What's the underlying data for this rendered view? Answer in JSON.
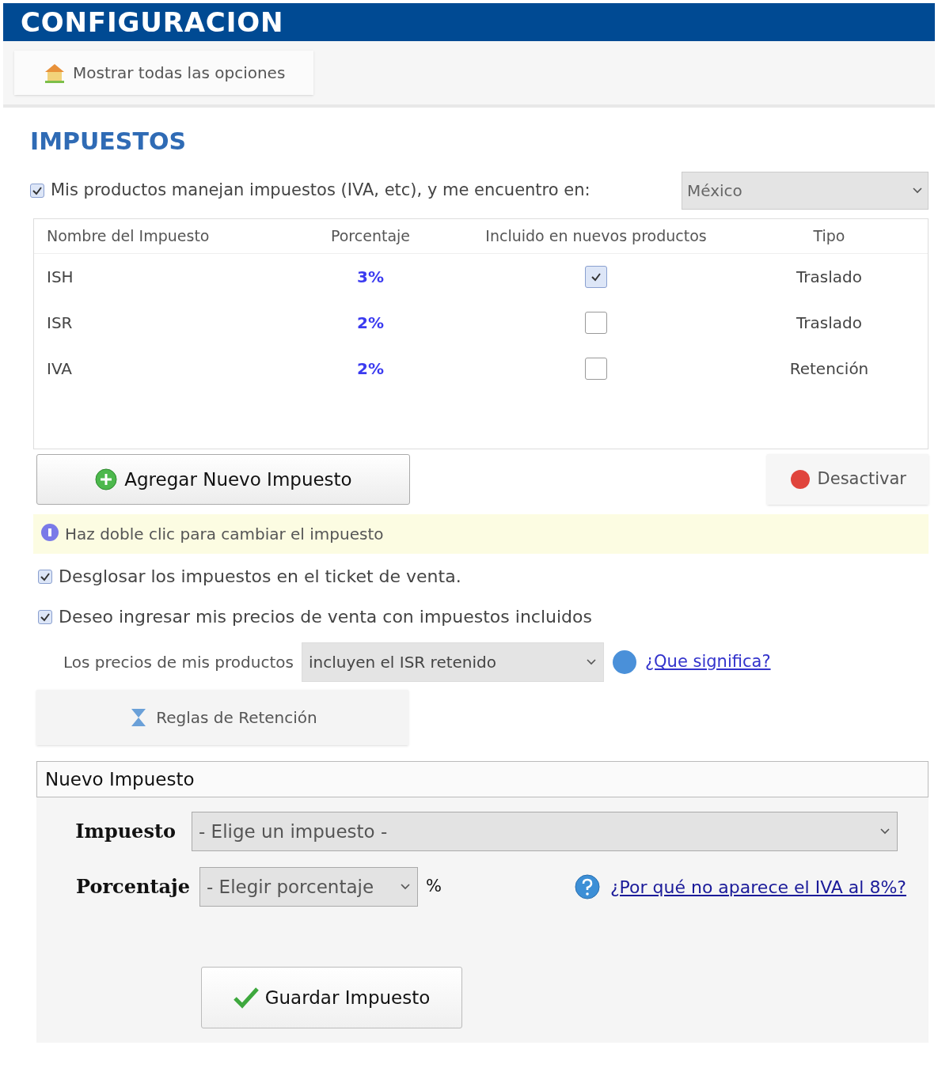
{
  "header": {
    "title": "CONFIGURACION"
  },
  "toolbar": {
    "button": "Mostrar todas las opciones"
  },
  "section": {
    "title": "IMPUESTOS"
  },
  "tax_enabled": {
    "checked": true,
    "label": "Mis productos manejan impuestos (IVA, etc), y me encuentro en:",
    "country": "México"
  },
  "table": {
    "columns": [
      "Nombre del Impuesto",
      "Porcentaje",
      "Incluido en nuevos productos",
      "Tipo"
    ],
    "rows": [
      {
        "name": "ISH",
        "percent": "3%",
        "included": true,
        "type": "Traslado"
      },
      {
        "name": "ISR",
        "percent": "2%",
        "included": false,
        "type": "Traslado"
      },
      {
        "name": "IVA",
        "percent": "2%",
        "included": false,
        "type": "Retención"
      }
    ]
  },
  "add_button": "Agregar Nuevo Impuesto",
  "deactivate_button": "Desactivar",
  "hint": "Haz doble clic para cambiar el impuesto",
  "options": [
    {
      "label": "Desglosar los impuestos en el ticket de venta.",
      "checked": true
    },
    {
      "label": "Deseo ingresar mis precios de venta con impuestos incluidos",
      "checked": true
    }
  ],
  "price_mode": {
    "label": "Los precios de mis productos",
    "value": "incluyen el ISR retenido",
    "help_link": "¿Que significa?"
  },
  "retention_button": "Reglas de Retención",
  "new_tax": {
    "title": "Nuevo Impuesto",
    "tax_label": "Impuesto",
    "tax_value": "- Elige un impuesto -",
    "percent_label": "Porcentaje",
    "percent_value": "- Elegir porcentaje",
    "percent_suffix": "%",
    "help_link": "¿Por qué no aparece el IVA al 8%?",
    "save_button": "Guardar Impuesto"
  }
}
